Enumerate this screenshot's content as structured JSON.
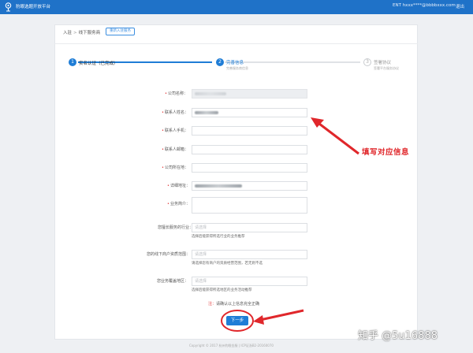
{
  "topbar": {
    "brand": "豹眼选题开放平台",
    "user": "ENT hxxx****@bbbbxxx.com",
    "logout": "退出"
  },
  "breadcrumb": {
    "first": "入驻",
    "separator": ">",
    "second": "线下服务商"
  },
  "reentry_button": "重新入驻服务",
  "steps": [
    {
      "number": "1",
      "label": "实名认证（已完成）",
      "sub": ""
    },
    {
      "number": "2",
      "label": "完善信息",
      "sub": "完善服务商信息"
    },
    {
      "number": "3",
      "label": "签署协议",
      "sub": "签署平台服务协议"
    }
  ],
  "form": {
    "company_name": {
      "label": "公司名称："
    },
    "contact_name": {
      "label": "联系人姓名："
    },
    "contact_phone": {
      "label": "联系人手机："
    },
    "contact_email": {
      "label": "联系人邮箱："
    },
    "company_location": {
      "label": "公司所在地："
    },
    "address": {
      "label": "详细地址："
    },
    "business_intro": {
      "label": "业务简介："
    },
    "industry": {
      "label": "您擅长服务的行业：",
      "placeholder": "请选择",
      "hint": "选择后能获得所选行业的业务推荐"
    },
    "business_scope": {
      "label": "您的线下商户资质范围：",
      "placeholder": "请选择",
      "hint": "请选择您有商户的资质经营范围，若无则不选"
    },
    "coverage_area": {
      "label": "您业务覆盖地区：",
      "placeholder": "请选择",
      "hint": "选择后能获得所选地区的业务活动推荐"
    }
  },
  "confirm_note": "请确认以上信息完全正确",
  "confirm_mark": "注：",
  "next_button": "下一步",
  "annotation": "填写对应信息",
  "footer": "Copyright © 2017 杭州豹眼金服 | ICP证浙B2-20160070",
  "watermark": "知乎 @5u16888",
  "colors": {
    "accent": "#1f7dd6",
    "topbar": "#1f72c8",
    "annotation_red": "#e0272b"
  }
}
